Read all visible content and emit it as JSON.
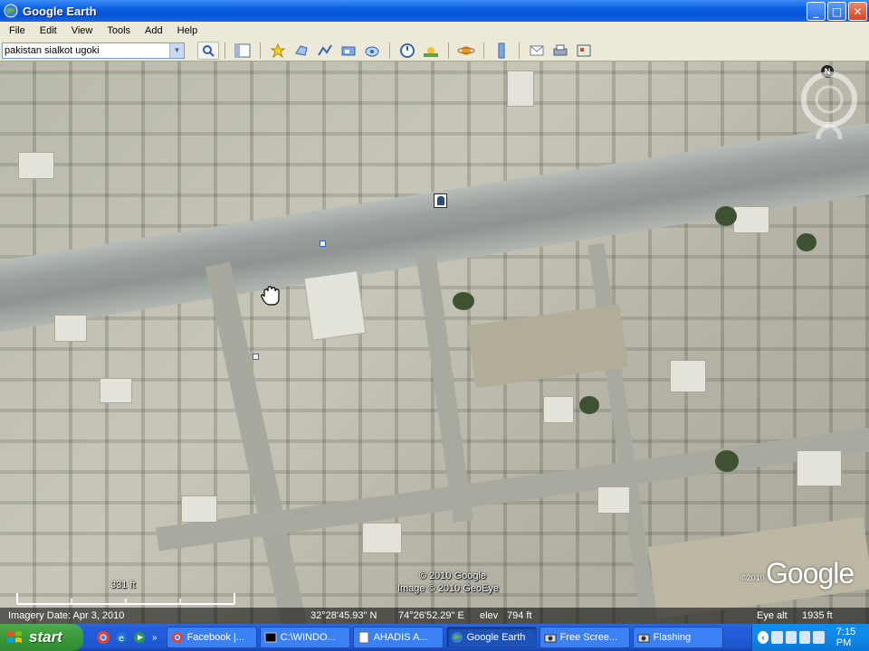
{
  "window": {
    "title": "Google Earth",
    "controls": {
      "minimize": "_",
      "maximize": "□",
      "close": "✕"
    }
  },
  "menu": {
    "items": [
      {
        "label": "File"
      },
      {
        "label": "Edit"
      },
      {
        "label": "View"
      },
      {
        "label": "Tools"
      },
      {
        "label": "Add"
      },
      {
        "label": "Help"
      }
    ]
  },
  "toolbar": {
    "search_value": "pakistan sialkot ugoki",
    "icons": [
      "sidebar-toggle-icon",
      "placemark-icon",
      "polygon-icon",
      "path-icon",
      "image-overlay-icon",
      "record-tour-icon",
      "historical-imagery-icon",
      "sunlight-icon",
      "planets-icon",
      "ruler-icon",
      "email-icon",
      "print-icon",
      "view-in-maps-icon"
    ]
  },
  "map": {
    "attribution_1": "© 2010 Google",
    "attribution_2": "Image © 2010 GeoEye",
    "copyright_small": "©2010",
    "logo": "Google",
    "compass_label": "N",
    "scale_label": "331 ft"
  },
  "status": {
    "imagery_date": "Imagery Date: Apr 3, 2010",
    "latitude": "32°28'45.93\" N",
    "longitude": "74°26'52.29\" E",
    "elev_label": "elev",
    "elev_value": "794 ft",
    "eye_alt_label": "Eye alt",
    "eye_alt_value": "1935 ft"
  },
  "taskbar": {
    "start_label": "start",
    "quicklaunch_more": "»",
    "tasks": [
      {
        "label": "Facebook |...",
        "icon": "chrome-icon",
        "active": false
      },
      {
        "label": "C:\\WINDO...",
        "icon": "cmd-icon",
        "active": false
      },
      {
        "label": "AHADIS A...",
        "icon": "document-icon",
        "active": false
      },
      {
        "label": "Google Earth",
        "icon": "google-earth-icon",
        "active": true
      },
      {
        "label": "Free Scree...",
        "icon": "camera-icon",
        "active": false
      },
      {
        "label": "Flashing",
        "icon": "camera-icon",
        "active": false
      }
    ],
    "clock": "7:15 PM"
  },
  "colors": {
    "titlebar": "#0553d6",
    "taskbar": "#245edb",
    "start": "#3a9a3a",
    "tray": "#1089e8",
    "menubar": "#ece9d8"
  }
}
